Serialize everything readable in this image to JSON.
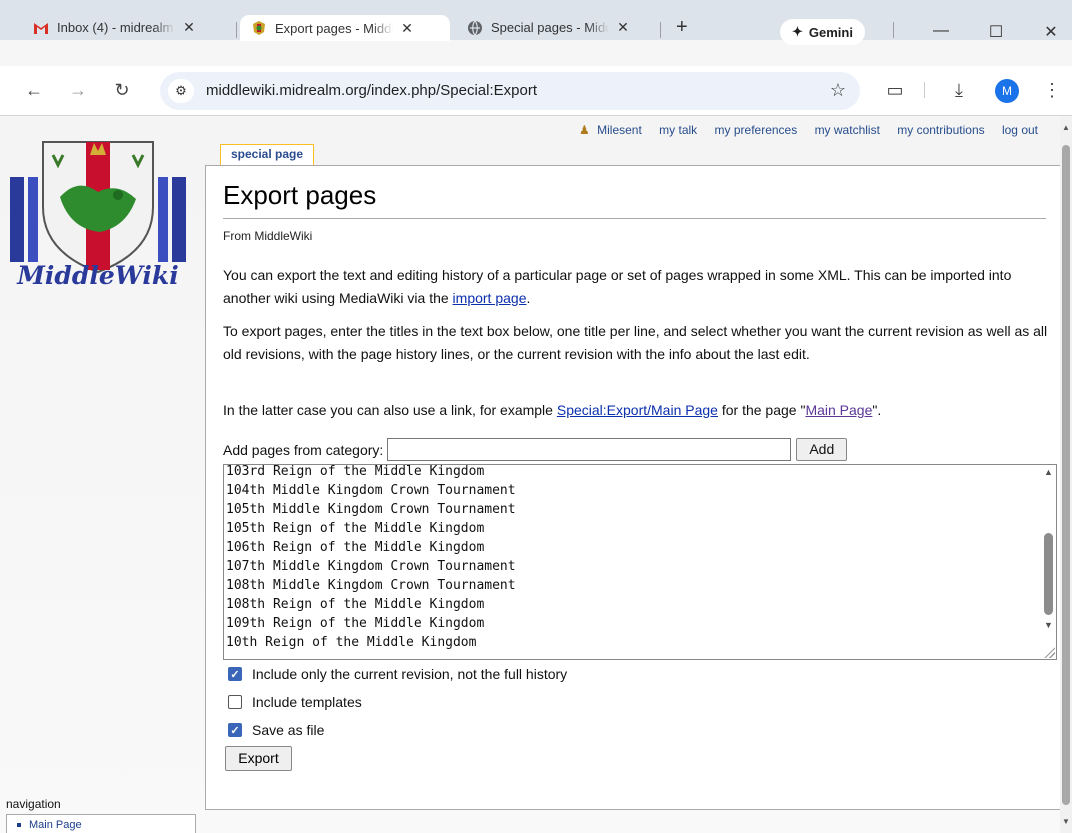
{
  "browser": {
    "tabs": [
      {
        "title": "Inbox (4) - midrealm",
        "icon": "gmail-icon"
      },
      {
        "title": "Export pages - MiddleWiki",
        "icon": "middlewiki-icon"
      },
      {
        "title": "Special pages - MiddleWiki",
        "icon": "globe-icon"
      }
    ],
    "new_tab": "+",
    "gemini_label": "Gemini",
    "url": "middlewiki.midrealm.org/index.php/Special:Export",
    "avatar_letter": "M"
  },
  "page": {
    "user_links": [
      "Milesent",
      "my talk",
      "my preferences",
      "my watchlist",
      "my contributions",
      "log out"
    ],
    "tab_label": "special page",
    "title": "Export pages",
    "from": "From MiddleWiki",
    "intro_1": "You can export the text and editing history of a particular page or set of pages wrapped in some XML. This can be imported into another wiki using MediaWiki via the ",
    "intro_1_link": "import page",
    "intro_1_end": ".",
    "intro_2": "To export pages, enter the titles in the text box below, one title per line, and select whether you want the current revision as well as all old revisions, with the page history lines, or the current revision with the info about the last edit.",
    "intro_3_a": "In the latter case you can also use a link, for example ",
    "intro_3_link": "Special:Export/Main Page",
    "intro_3_b": " for the page \"",
    "intro_3_link2": "Main Page",
    "intro_3_c": "\".",
    "category_label": "Add pages from category:",
    "category_value": "",
    "add_button": "Add",
    "pages_text": "103rd Reign of the Middle Kingdom\n104th Middle Kingdom Crown Tournament\n105th Middle Kingdom Crown Tournament\n105th Reign of the Middle Kingdom\n106th Reign of the Middle Kingdom\n107th Middle Kingdom Crown Tournament\n108th Middle Kingdom Crown Tournament\n108th Reign of the Middle Kingdom\n109th Reign of the Middle Kingdom\n10th Reign of the Middle Kingdom",
    "options": [
      {
        "label": "Include only the current revision, not the full history",
        "checked": true
      },
      {
        "label": "Include templates",
        "checked": false
      },
      {
        "label": "Save as file",
        "checked": true
      }
    ],
    "export_button": "Export",
    "nav_heading": "navigation",
    "nav_items": [
      "Main Page"
    ],
    "logo_text": "MiddleWiki"
  },
  "colors": {
    "link": "#0b2fad",
    "visited": "#5a3696",
    "checkbox": "#3a65b8",
    "tab_border": "#fabd23"
  }
}
